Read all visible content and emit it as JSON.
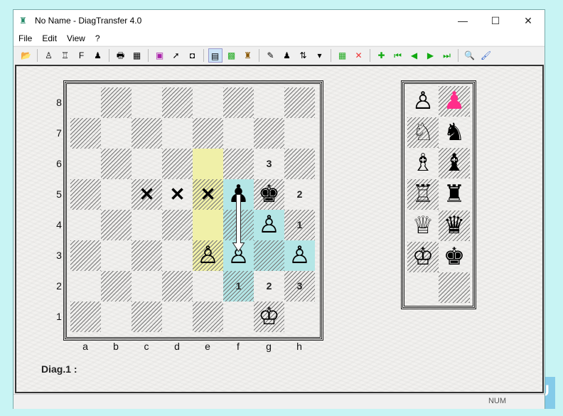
{
  "window": {
    "title": "No Name - DiagTransfer 4.0",
    "controls": [
      "minimize",
      "maximize",
      "close"
    ]
  },
  "menu": [
    "File",
    "Edit",
    "View",
    "?"
  ],
  "toolbar": [
    {
      "icon": "open-folder-icon",
      "glyph": "📂"
    },
    "sep",
    {
      "icon": "copy-diagram-icon",
      "glyph": "♙"
    },
    {
      "icon": "copy-diagram-2-icon",
      "glyph": "♖"
    },
    {
      "icon": "copy-fen-icon",
      "glyph": "F"
    },
    {
      "icon": "paste-icon",
      "glyph": "♟"
    },
    "sep",
    {
      "icon": "print-icon",
      "glyph": "🖶"
    },
    {
      "icon": "print-grid-icon",
      "glyph": "▦"
    },
    "sep",
    {
      "icon": "color-icon",
      "glyph": "▣"
    },
    {
      "icon": "draw-arrow-icon",
      "glyph": "➚"
    },
    {
      "icon": "border-icon",
      "glyph": "◘"
    },
    "sep",
    {
      "icon": "highlight-squares-icon",
      "glyph": "▤",
      "active": true
    },
    {
      "icon": "board-pattern-icon",
      "glyph": "▩"
    },
    {
      "icon": "piece-set-icon",
      "glyph": "♜"
    },
    "sep",
    {
      "icon": "pen-icon",
      "glyph": "✎"
    },
    {
      "icon": "player-icon",
      "glyph": "♟"
    },
    {
      "icon": "flip-arrows-icon",
      "glyph": "⇅"
    },
    {
      "icon": "dropdown-icon",
      "glyph": "▾"
    },
    "sep",
    {
      "icon": "new-board-icon",
      "glyph": "▦"
    },
    {
      "icon": "delete-icon",
      "glyph": "✕"
    },
    "sep",
    {
      "icon": "add-icon",
      "glyph": "✚"
    },
    {
      "icon": "first-icon",
      "glyph": "⏮"
    },
    {
      "icon": "prev-icon",
      "glyph": "◀"
    },
    {
      "icon": "next-icon",
      "glyph": "▶"
    },
    {
      "icon": "last-icon",
      "glyph": "⏭"
    },
    "sep",
    {
      "icon": "zoom-search-icon",
      "glyph": "🔍"
    },
    {
      "icon": "clean-brush-icon",
      "glyph": "🖌"
    }
  ],
  "board": {
    "files": [
      "a",
      "b",
      "c",
      "d",
      "e",
      "f",
      "g",
      "h"
    ],
    "ranks": [
      "8",
      "7",
      "6",
      "5",
      "4",
      "3",
      "2",
      "1"
    ],
    "colors": {
      "yellow": "#f0f0a8",
      "cyan": "#b4e6e6",
      "pink": "#ff2d8a"
    },
    "highlights": {
      "e6": "yellow",
      "e5": "yellow",
      "e4": "yellow",
      "e3": "yellow",
      "f5": "cyan",
      "f4": "cyan",
      "f3": "cyan",
      "f2": "cyan",
      "g4": "cyan",
      "g3": "cyan",
      "h3": "cyan"
    },
    "pieces": {
      "f5": "♟",
      "g5": "♚",
      "g4": "♙",
      "e3": "♙",
      "f3": "♙",
      "h3": "♙",
      "g1": "♔"
    },
    "marks": {
      "g6": "3",
      "h5": "2",
      "h4": "1",
      "f2": "1",
      "g2": "2",
      "h2": "3"
    },
    "crosses": {
      "c5": "✕",
      "d5": "✕",
      "e5": "✕"
    },
    "arrow": {
      "from": "f5",
      "to": "f3"
    }
  },
  "palette": [
    [
      "♙",
      "♟"
    ],
    [
      "♘",
      "♞"
    ],
    [
      "♗",
      "♝"
    ],
    [
      "♖",
      "♜"
    ],
    [
      "♕",
      "♛"
    ],
    [
      "♔",
      "♚"
    ],
    [
      "",
      ""
    ]
  ],
  "diagram_label": "Diag.1 :",
  "status": {
    "num": "NUM"
  },
  "watermark": "DOWNLOADS GURU"
}
